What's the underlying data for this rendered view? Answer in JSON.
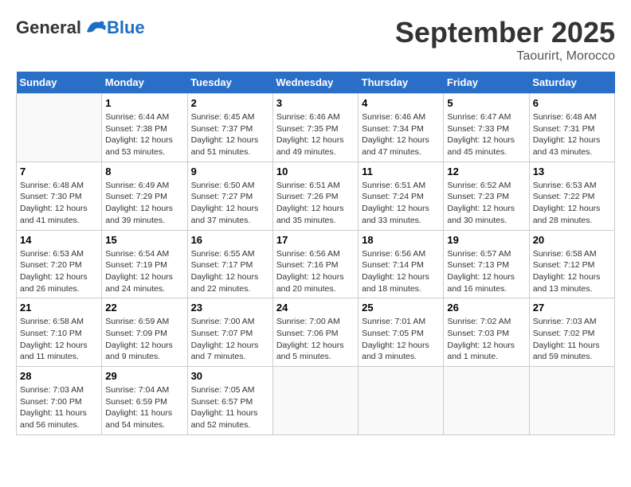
{
  "header": {
    "logo_general": "General",
    "logo_blue": "Blue",
    "month": "September 2025",
    "location": "Taourirt, Morocco"
  },
  "weekdays": [
    "Sunday",
    "Monday",
    "Tuesday",
    "Wednesday",
    "Thursday",
    "Friday",
    "Saturday"
  ],
  "weeks": [
    [
      {
        "day": "",
        "empty": true
      },
      {
        "day": "1",
        "sunrise": "Sunrise: 6:44 AM",
        "sunset": "Sunset: 7:38 PM",
        "daylight": "Daylight: 12 hours and 53 minutes."
      },
      {
        "day": "2",
        "sunrise": "Sunrise: 6:45 AM",
        "sunset": "Sunset: 7:37 PM",
        "daylight": "Daylight: 12 hours and 51 minutes."
      },
      {
        "day": "3",
        "sunrise": "Sunrise: 6:46 AM",
        "sunset": "Sunset: 7:35 PM",
        "daylight": "Daylight: 12 hours and 49 minutes."
      },
      {
        "day": "4",
        "sunrise": "Sunrise: 6:46 AM",
        "sunset": "Sunset: 7:34 PM",
        "daylight": "Daylight: 12 hours and 47 minutes."
      },
      {
        "day": "5",
        "sunrise": "Sunrise: 6:47 AM",
        "sunset": "Sunset: 7:33 PM",
        "daylight": "Daylight: 12 hours and 45 minutes."
      },
      {
        "day": "6",
        "sunrise": "Sunrise: 6:48 AM",
        "sunset": "Sunset: 7:31 PM",
        "daylight": "Daylight: 12 hours and 43 minutes."
      }
    ],
    [
      {
        "day": "7",
        "sunrise": "Sunrise: 6:48 AM",
        "sunset": "Sunset: 7:30 PM",
        "daylight": "Daylight: 12 hours and 41 minutes."
      },
      {
        "day": "8",
        "sunrise": "Sunrise: 6:49 AM",
        "sunset": "Sunset: 7:29 PM",
        "daylight": "Daylight: 12 hours and 39 minutes."
      },
      {
        "day": "9",
        "sunrise": "Sunrise: 6:50 AM",
        "sunset": "Sunset: 7:27 PM",
        "daylight": "Daylight: 12 hours and 37 minutes."
      },
      {
        "day": "10",
        "sunrise": "Sunrise: 6:51 AM",
        "sunset": "Sunset: 7:26 PM",
        "daylight": "Daylight: 12 hours and 35 minutes."
      },
      {
        "day": "11",
        "sunrise": "Sunrise: 6:51 AM",
        "sunset": "Sunset: 7:24 PM",
        "daylight": "Daylight: 12 hours and 33 minutes."
      },
      {
        "day": "12",
        "sunrise": "Sunrise: 6:52 AM",
        "sunset": "Sunset: 7:23 PM",
        "daylight": "Daylight: 12 hours and 30 minutes."
      },
      {
        "day": "13",
        "sunrise": "Sunrise: 6:53 AM",
        "sunset": "Sunset: 7:22 PM",
        "daylight": "Daylight: 12 hours and 28 minutes."
      }
    ],
    [
      {
        "day": "14",
        "sunrise": "Sunrise: 6:53 AM",
        "sunset": "Sunset: 7:20 PM",
        "daylight": "Daylight: 12 hours and 26 minutes."
      },
      {
        "day": "15",
        "sunrise": "Sunrise: 6:54 AM",
        "sunset": "Sunset: 7:19 PM",
        "daylight": "Daylight: 12 hours and 24 minutes."
      },
      {
        "day": "16",
        "sunrise": "Sunrise: 6:55 AM",
        "sunset": "Sunset: 7:17 PM",
        "daylight": "Daylight: 12 hours and 22 minutes."
      },
      {
        "day": "17",
        "sunrise": "Sunrise: 6:56 AM",
        "sunset": "Sunset: 7:16 PM",
        "daylight": "Daylight: 12 hours and 20 minutes."
      },
      {
        "day": "18",
        "sunrise": "Sunrise: 6:56 AM",
        "sunset": "Sunset: 7:14 PM",
        "daylight": "Daylight: 12 hours and 18 minutes."
      },
      {
        "day": "19",
        "sunrise": "Sunrise: 6:57 AM",
        "sunset": "Sunset: 7:13 PM",
        "daylight": "Daylight: 12 hours and 16 minutes."
      },
      {
        "day": "20",
        "sunrise": "Sunrise: 6:58 AM",
        "sunset": "Sunset: 7:12 PM",
        "daylight": "Daylight: 12 hours and 13 minutes."
      }
    ],
    [
      {
        "day": "21",
        "sunrise": "Sunrise: 6:58 AM",
        "sunset": "Sunset: 7:10 PM",
        "daylight": "Daylight: 12 hours and 11 minutes."
      },
      {
        "day": "22",
        "sunrise": "Sunrise: 6:59 AM",
        "sunset": "Sunset: 7:09 PM",
        "daylight": "Daylight: 12 hours and 9 minutes."
      },
      {
        "day": "23",
        "sunrise": "Sunrise: 7:00 AM",
        "sunset": "Sunset: 7:07 PM",
        "daylight": "Daylight: 12 hours and 7 minutes."
      },
      {
        "day": "24",
        "sunrise": "Sunrise: 7:00 AM",
        "sunset": "Sunset: 7:06 PM",
        "daylight": "Daylight: 12 hours and 5 minutes."
      },
      {
        "day": "25",
        "sunrise": "Sunrise: 7:01 AM",
        "sunset": "Sunset: 7:05 PM",
        "daylight": "Daylight: 12 hours and 3 minutes."
      },
      {
        "day": "26",
        "sunrise": "Sunrise: 7:02 AM",
        "sunset": "Sunset: 7:03 PM",
        "daylight": "Daylight: 12 hours and 1 minute."
      },
      {
        "day": "27",
        "sunrise": "Sunrise: 7:03 AM",
        "sunset": "Sunset: 7:02 PM",
        "daylight": "Daylight: 11 hours and 59 minutes."
      }
    ],
    [
      {
        "day": "28",
        "sunrise": "Sunrise: 7:03 AM",
        "sunset": "Sunset: 7:00 PM",
        "daylight": "Daylight: 11 hours and 56 minutes."
      },
      {
        "day": "29",
        "sunrise": "Sunrise: 7:04 AM",
        "sunset": "Sunset: 6:59 PM",
        "daylight": "Daylight: 11 hours and 54 minutes."
      },
      {
        "day": "30",
        "sunrise": "Sunrise: 7:05 AM",
        "sunset": "Sunset: 6:57 PM",
        "daylight": "Daylight: 11 hours and 52 minutes."
      },
      {
        "day": "",
        "empty": true
      },
      {
        "day": "",
        "empty": true
      },
      {
        "day": "",
        "empty": true
      },
      {
        "day": "",
        "empty": true
      }
    ]
  ]
}
